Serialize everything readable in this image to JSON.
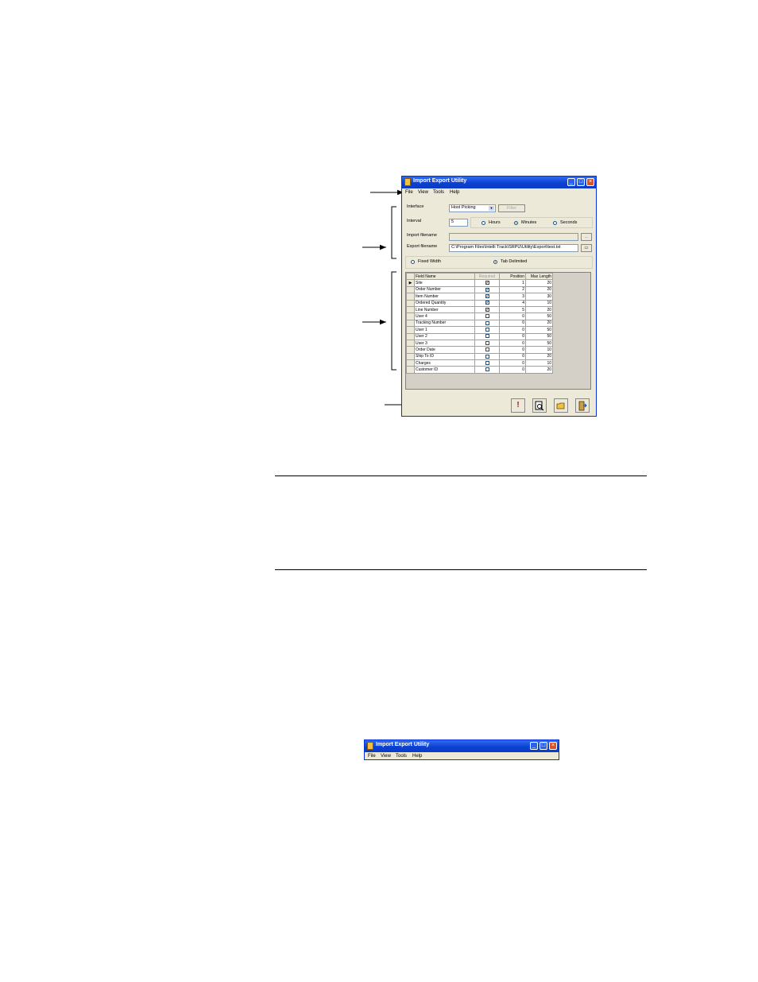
{
  "window": {
    "title": "Import Export Utility",
    "menu": [
      "File",
      "View",
      "Tools",
      "Help"
    ],
    "interface_label": "Interface",
    "interface_value": "Host Picking",
    "filter_label": "Filter",
    "interval_label": "Interval",
    "interval_value": "5",
    "interval_units": [
      "Hours",
      "Minutes",
      "Seconds"
    ],
    "interval_selected": "Minutes",
    "import_label": "Import filename",
    "export_label": "Export filename",
    "export_value": "C:\\Program Files\\Intelli Track\\SRPU\\Utility\\Export\\test.txt",
    "format_options": [
      "Fixed Width",
      "Tab Delimited"
    ],
    "format_selected": "Tab Delimited",
    "grid_headers": [
      "Field Name",
      "Required",
      "Position",
      "Max Length"
    ],
    "grid_rows": [
      {
        "field": "Site",
        "required": true,
        "position": "1",
        "max_length": "20"
      },
      {
        "field": "Order Number",
        "required": true,
        "position": "2",
        "max_length": "20"
      },
      {
        "field": "Item Number",
        "required": true,
        "position": "3",
        "max_length": "30"
      },
      {
        "field": "Ordered Quantity",
        "required": true,
        "position": "4",
        "max_length": "10"
      },
      {
        "field": "Line Number",
        "required": true,
        "position": "5",
        "max_length": "20"
      },
      {
        "field": "User 4",
        "required": false,
        "position": "0",
        "max_length": "50"
      },
      {
        "field": "Tracking Number",
        "required": false,
        "position": "0",
        "max_length": "20"
      },
      {
        "field": "User 1",
        "required": false,
        "position": "0",
        "max_length": "50"
      },
      {
        "field": "User 2",
        "required": false,
        "position": "0",
        "max_length": "50"
      },
      {
        "field": "User 3",
        "required": false,
        "position": "0",
        "max_length": "50"
      },
      {
        "field": "Order Date",
        "required": false,
        "position": "0",
        "max_length": "10"
      },
      {
        "field": "Ship To ID",
        "required": false,
        "position": "0",
        "max_length": "20"
      },
      {
        "field": "Charges",
        "required": false,
        "position": "0",
        "max_length": "10"
      },
      {
        "field": "Customer ID",
        "required": false,
        "position": "0",
        "max_length": "20"
      }
    ],
    "toolbar_icons": [
      "exclamation-icon",
      "preview-icon",
      "folder-icon",
      "exit-door-icon"
    ]
  },
  "window2": {
    "title": "Import Export Utility",
    "menu": [
      "File",
      "View",
      "Tools",
      "Help"
    ]
  },
  "colors": {
    "titlebar": "#0a3fd0",
    "window_bg": "#ece9d8",
    "close_button": "#d9532c"
  }
}
